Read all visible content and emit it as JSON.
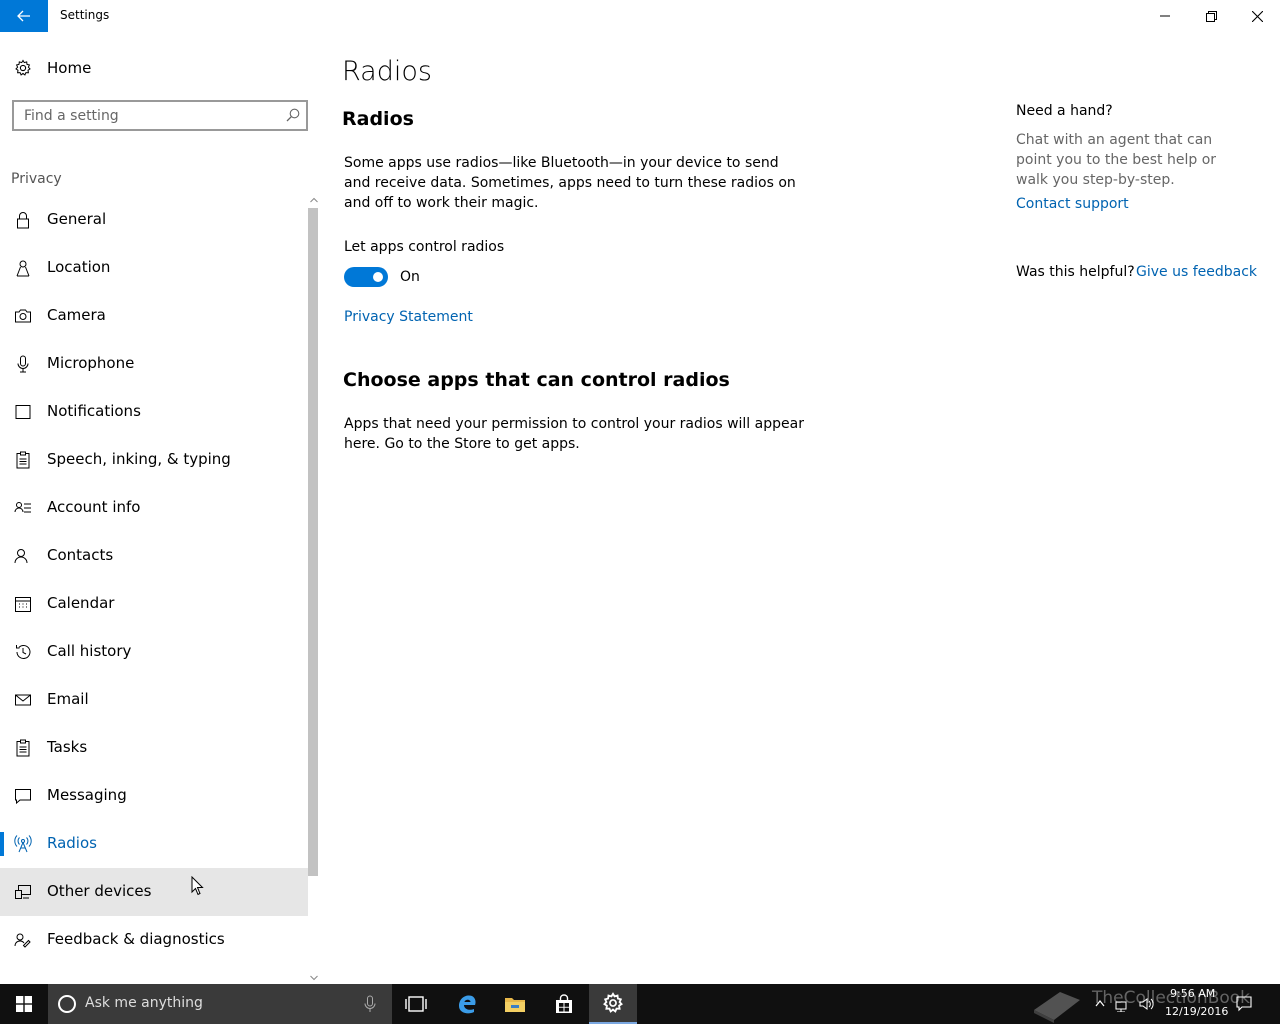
{
  "window": {
    "title": "Settings"
  },
  "sidebar": {
    "home_label": "Home",
    "search_placeholder": "Find a setting",
    "section": "Privacy",
    "items": [
      {
        "label": "General",
        "icon": "lock-icon"
      },
      {
        "label": "Location",
        "icon": "location-icon"
      },
      {
        "label": "Camera",
        "icon": "camera-icon"
      },
      {
        "label": "Microphone",
        "icon": "microphone-icon"
      },
      {
        "label": "Notifications",
        "icon": "notifications-icon"
      },
      {
        "label": "Speech, inking, & typing",
        "icon": "speech-icon"
      },
      {
        "label": "Account info",
        "icon": "account-info-icon"
      },
      {
        "label": "Contacts",
        "icon": "contacts-icon"
      },
      {
        "label": "Calendar",
        "icon": "calendar-icon"
      },
      {
        "label": "Call history",
        "icon": "history-icon"
      },
      {
        "label": "Email",
        "icon": "email-icon"
      },
      {
        "label": "Tasks",
        "icon": "tasks-icon"
      },
      {
        "label": "Messaging",
        "icon": "messaging-icon"
      },
      {
        "label": "Radios",
        "icon": "radios-icon",
        "selected": true
      },
      {
        "label": "Other devices",
        "icon": "other-devices-icon",
        "hovered": true
      },
      {
        "label": "Feedback & diagnostics",
        "icon": "feedback-icon"
      }
    ]
  },
  "main": {
    "page_title": "Radios",
    "sub_title": "Radios",
    "description": "Some apps use radios—like Bluetooth—in your device to send and receive data. Sometimes, apps need to turn these radios on and off to work their magic.",
    "toggle_label": "Let apps control radios",
    "toggle_state": "On",
    "privacy_link": "Privacy Statement",
    "choose_title": "Choose apps that can control radios",
    "choose_desc": "Apps that need your permission to control your radios will appear here. Go to the Store to get apps."
  },
  "help": {
    "title": "Need a hand?",
    "desc": "Chat with an agent that can point you to the best help or walk you step-by-step.",
    "contact_link": "Contact support",
    "helpful_label": "Was this helpful?",
    "feedback_link": "Give us feedback"
  },
  "taskbar": {
    "search_placeholder": "Ask me anything",
    "time": "9:56 AM",
    "date": "12/19/2016",
    "watermark": "TheCollectionBook"
  },
  "colors": {
    "accent": "#0078d7",
    "link": "#0063b1",
    "hover": "#e6e6e6",
    "taskbar": "#101010"
  }
}
